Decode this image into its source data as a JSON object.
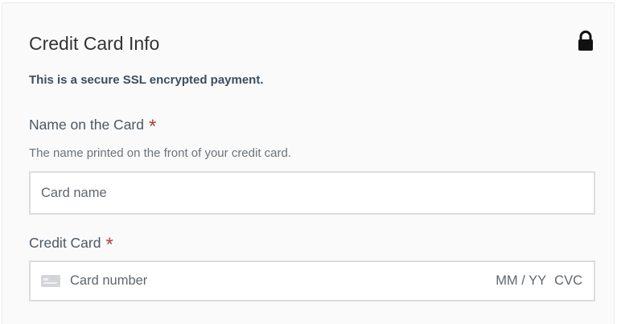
{
  "form": {
    "title": "Credit Card Info",
    "secure_note": "This is a secure SSL encrypted payment.",
    "name_field": {
      "label": "Name on the Card",
      "required_mark": "*",
      "help_text": "The name printed on the front of your credit card.",
      "placeholder": "Card name",
      "value": ""
    },
    "card_field": {
      "label": "Credit Card",
      "required_mark": "*",
      "number_placeholder": "Card number",
      "expiry_placeholder": "MM / YY",
      "cvc_placeholder": "CVC",
      "icon": "credit-card-icon"
    },
    "lock_icon": "lock-icon"
  },
  "colors": {
    "required": "#b04040",
    "secure_text": "#3c4e60",
    "panel_bg": "#fafafa",
    "field_border": "#dcdcdc"
  }
}
